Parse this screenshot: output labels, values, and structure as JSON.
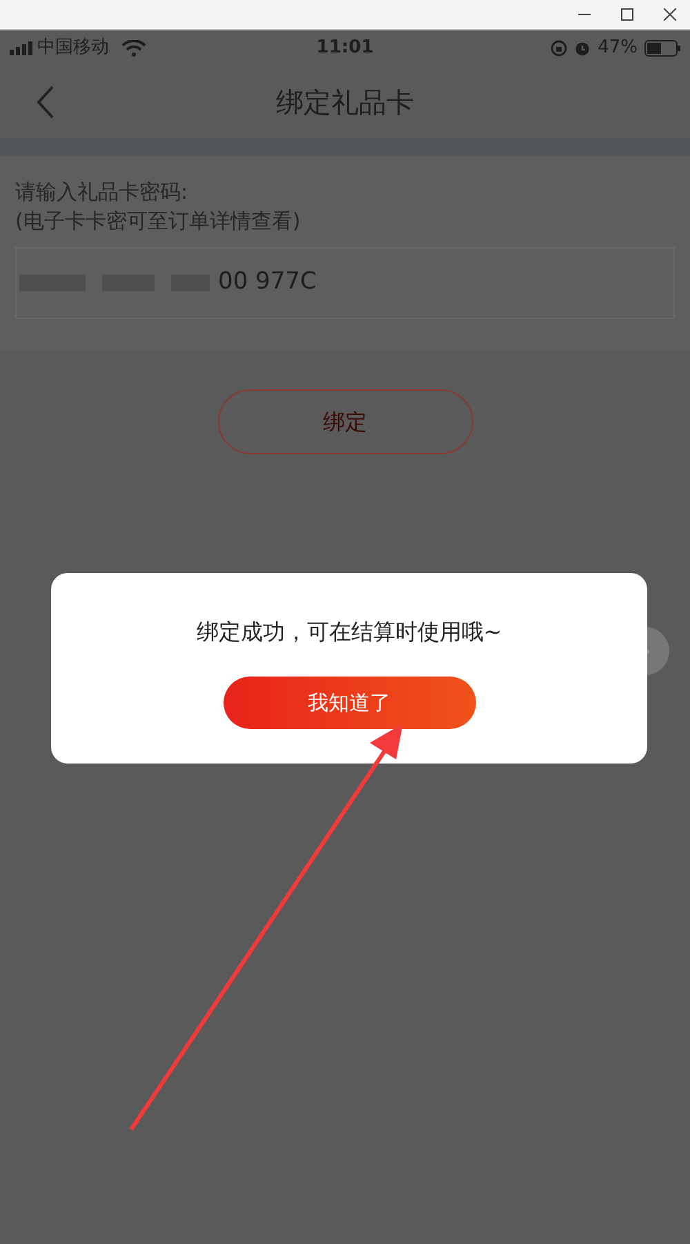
{
  "status_bar": {
    "carrier": "中国移动",
    "time": "11:01",
    "battery": "47%"
  },
  "nav": {
    "title": "绑定礼品卡"
  },
  "form": {
    "label": "请输入礼品卡密码:",
    "hint": "(电子卡卡密可至订单详情查看)",
    "value": "00 977C",
    "button": "绑定"
  },
  "dialog": {
    "message": "绑定成功，可在结算时使用哦~",
    "button": "我知道了"
  }
}
